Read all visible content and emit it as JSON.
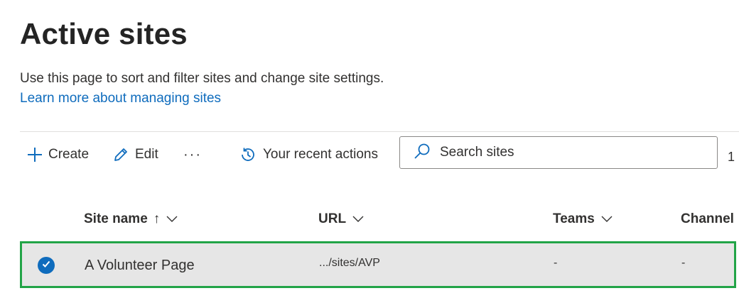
{
  "page": {
    "title": "Active sites",
    "description": "Use this page to sort and filter sites and change site settings.",
    "learn_more": "Learn more about managing sites"
  },
  "toolbar": {
    "create_label": "Create",
    "edit_label": "Edit",
    "more_label": "···",
    "recent_label": "Your recent actions",
    "count": "1"
  },
  "search": {
    "placeholder": "Search sites"
  },
  "table": {
    "columns": [
      {
        "label": "Site name",
        "sort": "↑"
      },
      {
        "label": "URL"
      },
      {
        "label": "Teams"
      },
      {
        "label": "Channel"
      }
    ],
    "rows": [
      {
        "site_name": "A Volunteer Page",
        "url": ".../sites/AVP",
        "teams": "-",
        "channel": "-",
        "selected": true
      }
    ]
  },
  "colors": {
    "accent": "#0f6cbd",
    "highlight_border": "#22a447",
    "selected_row_bg": "#e6e6e6"
  }
}
